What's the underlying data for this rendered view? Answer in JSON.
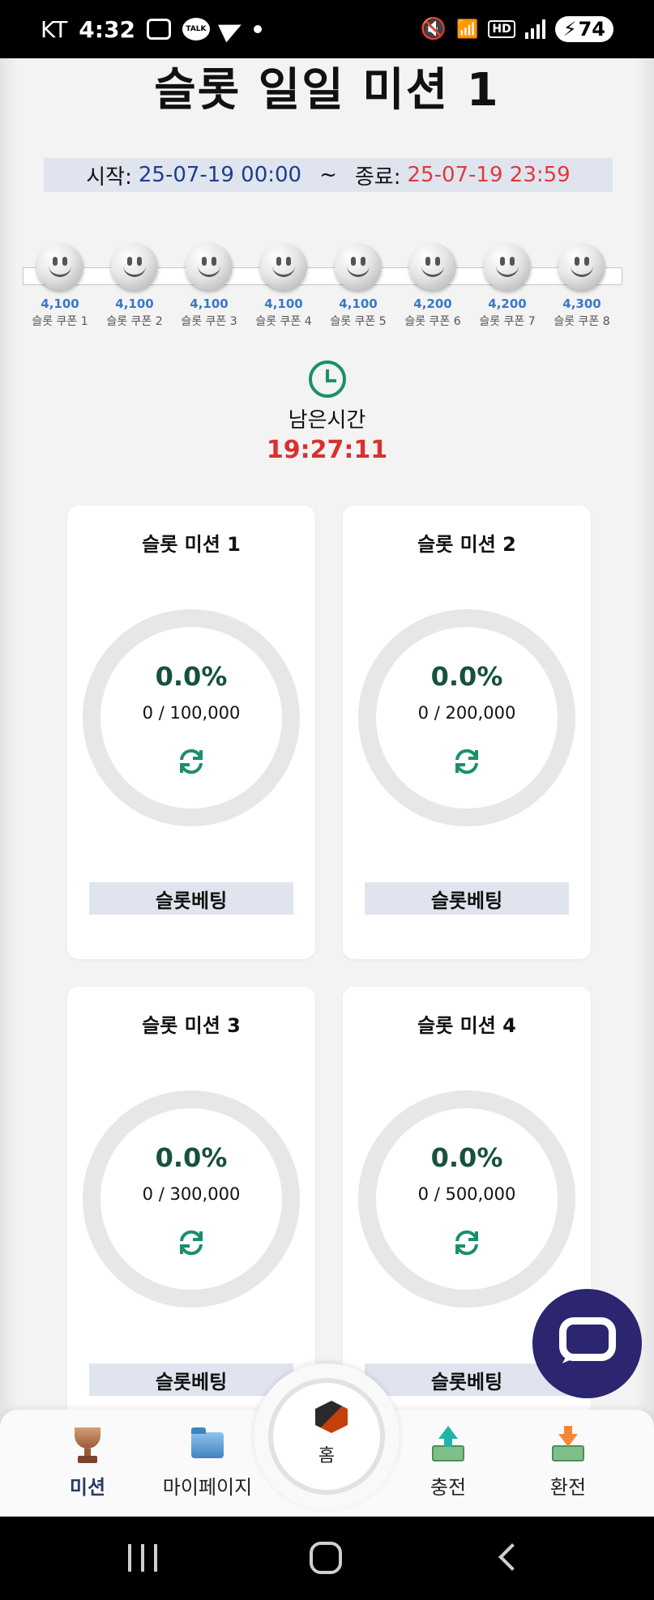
{
  "status_bar": {
    "carrier": "KT",
    "time": "4:32",
    "talk_badge": "TALK",
    "hd_badge": "HD",
    "battery": "74"
  },
  "page": {
    "title": "슬롯 일일 미션 1",
    "start_label": "시작:",
    "start_value": "25-07-19 00:00",
    "separator": "~",
    "end_label": "종료:",
    "end_value": "25-07-19 23:59"
  },
  "coupons": [
    {
      "amount": "4,100",
      "name": "슬롯 쿠폰 1"
    },
    {
      "amount": "4,100",
      "name": "슬롯 쿠폰 2"
    },
    {
      "amount": "4,100",
      "name": "슬롯 쿠폰 3"
    },
    {
      "amount": "4,100",
      "name": "슬롯 쿠폰 4"
    },
    {
      "amount": "4,100",
      "name": "슬롯 쿠폰 5"
    },
    {
      "amount": "4,200",
      "name": "슬롯 쿠폰 6"
    },
    {
      "amount": "4,200",
      "name": "슬롯 쿠폰 7"
    },
    {
      "amount": "4,300",
      "name": "슬롯 쿠폰 8"
    }
  ],
  "remaining": {
    "label": "남은시간",
    "time": "19:27:11"
  },
  "missions": [
    {
      "title": "슬롯 미션 1",
      "percent": "0.0%",
      "progress": "0 / 100,000",
      "button": "슬롯베팅"
    },
    {
      "title": "슬롯 미션 2",
      "percent": "0.0%",
      "progress": "0 / 200,000",
      "button": "슬롯베팅"
    },
    {
      "title": "슬롯 미션 3",
      "percent": "0.0%",
      "progress": "0 / 300,000",
      "button": "슬롯베팅"
    },
    {
      "title": "슬롯 미션 4",
      "percent": "0.0%",
      "progress": "0 / 500,000",
      "button": "슬롯베팅"
    }
  ],
  "bottom_nav": {
    "mission": "미션",
    "mypage": "마이페이지",
    "home": "홈",
    "deposit": "충전",
    "withdraw": "환전"
  },
  "colors": {
    "accent_navy": "#2c256f",
    "period_blue": "#1b3f8c",
    "period_red": "#e03a3a",
    "timer_red": "#d93030",
    "progress_green": "#17523a",
    "icon_teal": "#1a8f6e"
  }
}
